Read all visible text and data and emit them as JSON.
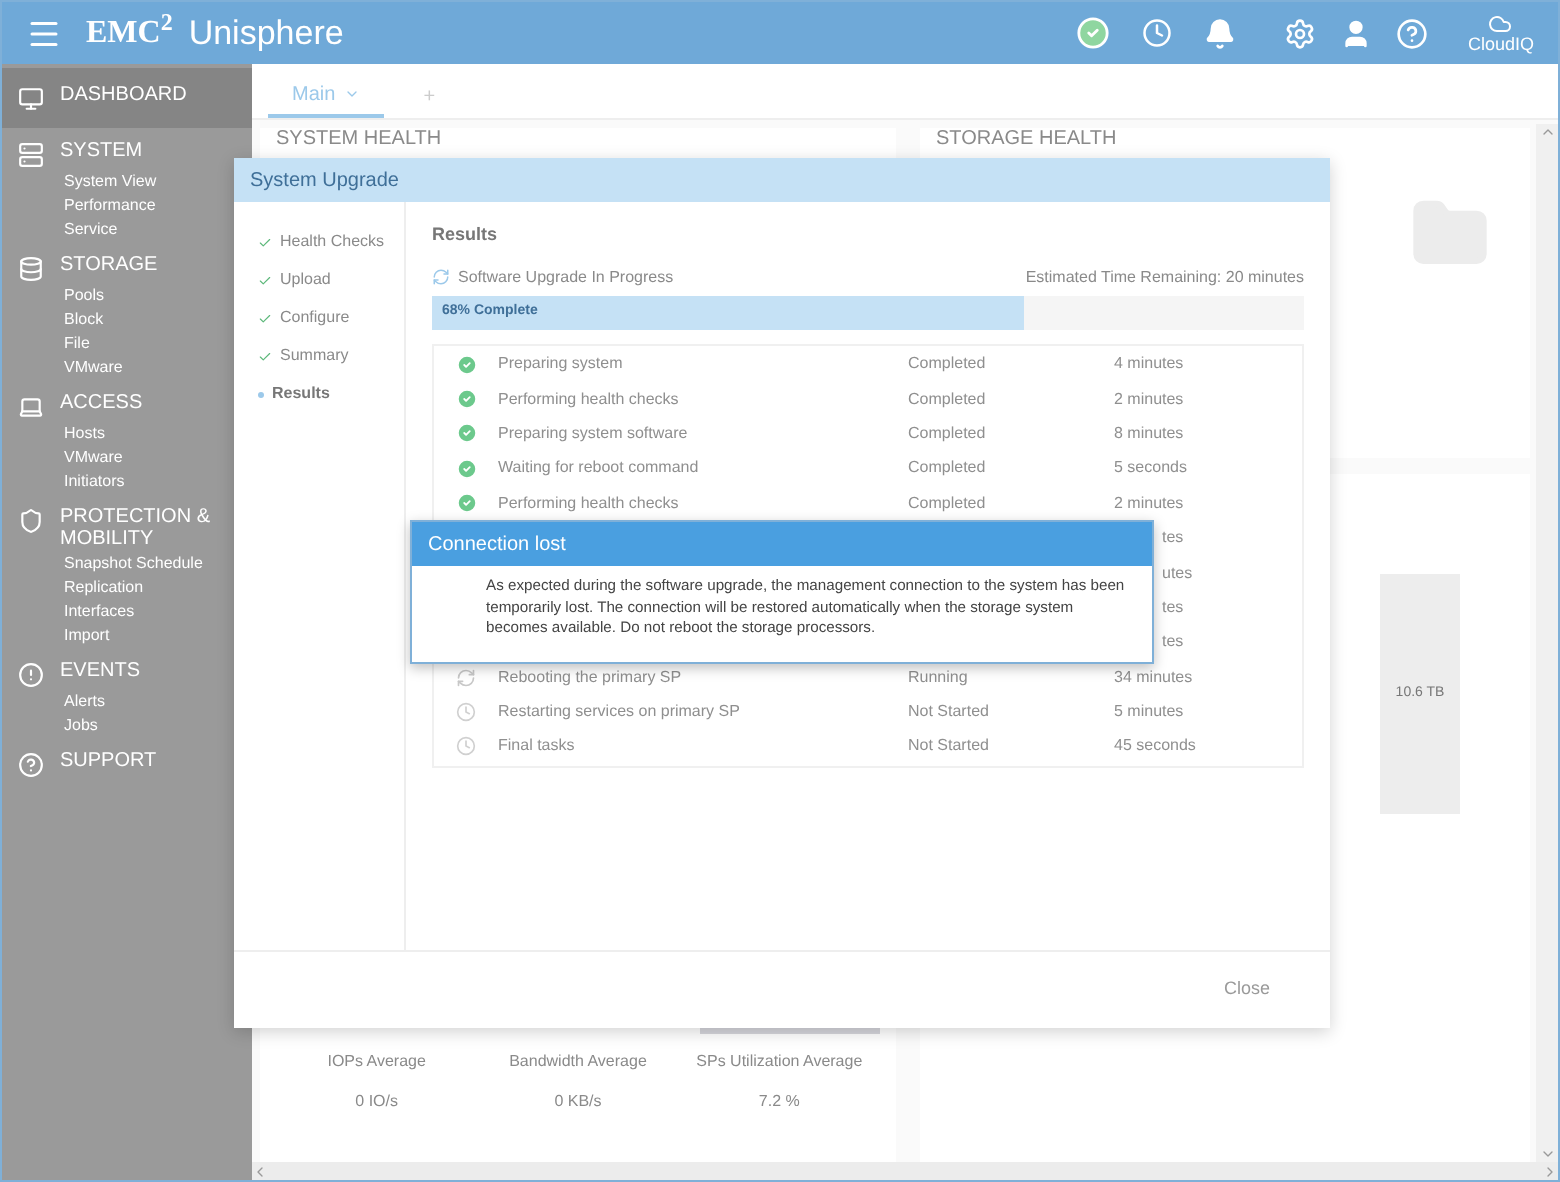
{
  "header": {
    "logo": "EMC$^{2}$",
    "app_name": "Unisphere",
    "cloud_label": "CloudIQ"
  },
  "sidebar": {
    "sections": [
      {
        "kind": "dashboard",
        "title": "DASHBOARD",
        "selected": true
      },
      {
        "kind": "system",
        "title": "SYSTEM",
        "selected": false,
        "items": [
          "System View",
          "Performance",
          "Service"
        ]
      },
      {
        "kind": "storage",
        "title": "STORAGE",
        "selected": false,
        "items": [
          "Pools",
          "Block",
          "File",
          "VMware"
        ]
      },
      {
        "kind": "access",
        "title": "ACCESS",
        "selected": false,
        "items": [
          "Hosts",
          "VMware",
          "Initiators"
        ]
      },
      {
        "kind": "protection",
        "title": "PROTECTION & MOBILITY",
        "selected": false,
        "items": [
          "Snapshot Schedule",
          "Replication",
          "Interfaces",
          "Import"
        ]
      },
      {
        "kind": "events",
        "title": "EVENTS",
        "selected": false,
        "items": [
          "Alerts",
          "Jobs"
        ]
      },
      {
        "kind": "support",
        "title": "SUPPORT",
        "selected": false
      }
    ]
  },
  "tabs": [
    {
      "label": "Main",
      "selected": true
    },
    {
      "label": "+",
      "selected": false
    }
  ],
  "cards": {
    "system_health": "SYSTEM HEALTH",
    "storage_health": "STORAGE HEALTH",
    "capacity_value": "10.6 TB",
    "stats": [
      {
        "label": "IOPs Average",
        "value": "0 IO/s"
      },
      {
        "label": "Bandwidth Average",
        "value": "0 KB/s"
      },
      {
        "label": "SPs Utilization Average",
        "value": "7.2 %"
      }
    ]
  },
  "upgrade_dialog": {
    "title": "System Upgrade",
    "steps": [
      {
        "label": "Health Checks",
        "selected": false
      },
      {
        "label": "Upload",
        "selected": false
      },
      {
        "label": "Configure",
        "selected": false
      },
      {
        "label": "Summary",
        "selected": false
      },
      {
        "label": "Results",
        "selected": true
      }
    ],
    "heading": "Results",
    "progress_title": "Software Upgrade In Progress",
    "time_remaining": "Estimated Time Remaining: 20 minutes",
    "progress": {
      "label": "68% Complete",
      "level": 0.68
    },
    "tasks": [
      {
        "kind": "completed",
        "name": "Preparing system",
        "status": "Completed",
        "duration": "4 minutes"
      },
      {
        "kind": "completed",
        "name": "Performing health checks",
        "status": "Completed",
        "duration": "2 minutes"
      },
      {
        "kind": "completed",
        "name": "Preparing system software",
        "status": "Completed",
        "duration": "8 minutes"
      },
      {
        "kind": "completed",
        "name": "Waiting for reboot command",
        "status": "Completed",
        "duration": "5 seconds"
      },
      {
        "kind": "completed",
        "name": "Performing health checks",
        "status": "Completed",
        "duration": "2 minutes"
      },
      {
        "kind": "hidden",
        "duration": "tes"
      },
      {
        "kind": "hidden",
        "duration": "utes"
      },
      {
        "kind": "hidden",
        "duration": "tes"
      },
      {
        "kind": "hidden",
        "duration": "tes"
      },
      {
        "kind": "running",
        "name": "Rebooting the primary SP",
        "status": "Running",
        "duration": "34 minutes"
      },
      {
        "kind": "not_started",
        "name": "Restarting services on primary SP",
        "status": "Not Started",
        "duration": "5 minutes"
      },
      {
        "kind": "not_started",
        "name": "Final tasks",
        "status": "Not Started",
        "duration": "45 seconds"
      }
    ],
    "close_button": {
      "label": "Close",
      "disabled": true
    }
  },
  "connection_dialog": {
    "title": "Connection lost",
    "message": "As expected during the software upgrade, the management connection to the system has been temporarily lost. The connection will be restored automatically when the storage system becomes available. Do not reboot the storage processors."
  }
}
